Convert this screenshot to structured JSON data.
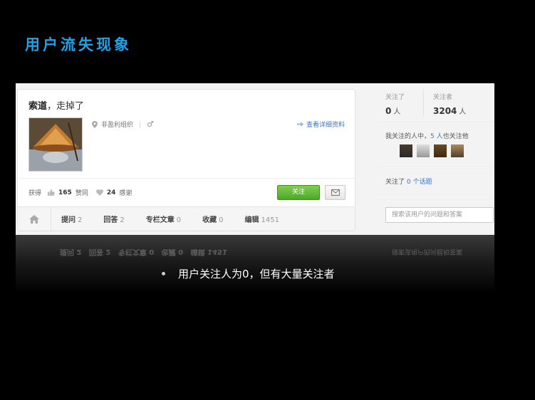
{
  "slide": {
    "title": "用户流失现象",
    "bullet": "用户关注人为0，但有大量关注者"
  },
  "profile": {
    "name": "索道",
    "name_sep": "，",
    "tagline": "走掉了",
    "org": "非盈利组织",
    "gender_symbol": "♂",
    "detail_link": "查看详细资料",
    "stats_prefix": "获得",
    "agree_count": "165",
    "agree_label": "赞同",
    "thanks_count": "24",
    "thanks_label": "感谢",
    "follow_button": "关注"
  },
  "tabs": [
    {
      "label": "提问",
      "count": "2"
    },
    {
      "label": "回答",
      "count": "2"
    },
    {
      "label": "专栏文章",
      "count": "0"
    },
    {
      "label": "收藏",
      "count": "0"
    },
    {
      "label": "编辑",
      "count": "1451"
    }
  ],
  "sidebar": {
    "following_label": "关注了",
    "following_count": "0",
    "following_unit": "人",
    "followers_label": "关注者",
    "followers_count": "3204",
    "followers_unit": "人",
    "mutual_prefix": "我关注的人中，",
    "mutual_count": "5 人",
    "mutual_suffix": "也关注他",
    "topics_prefix": "关注了",
    "topics_count": "0 个话题",
    "search_placeholder": "搜索该用户的问题和答案"
  },
  "reflection_text": {
    "tabs": "提问 2   回答 2   专栏文章 0   收藏 0   编辑 1451",
    "search": "搜索该用户的问题和答案"
  },
  "colors": {
    "title": "#1fa3e6",
    "link": "#3a77c2",
    "follow_button": "#4ea72a"
  }
}
